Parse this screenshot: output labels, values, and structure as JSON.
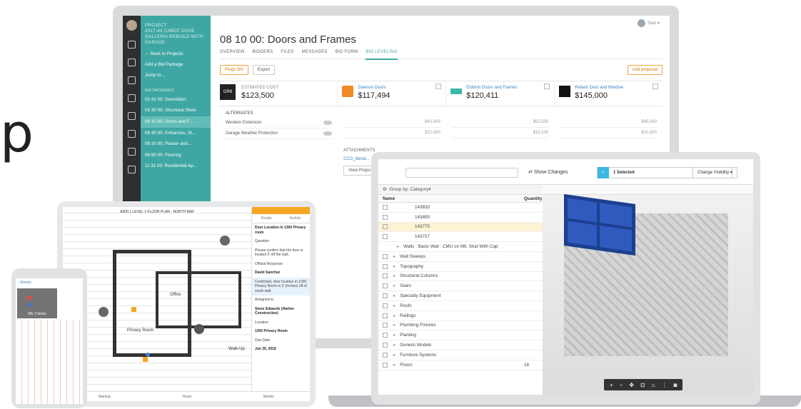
{
  "glyph": "p",
  "desktop": {
    "user": "Stan",
    "project_label": "PROJECT",
    "project_name": "2017-43 CABOT COVE GALLERIA REBUILD WITH GARAGE",
    "nav": [
      "← Back to Projects",
      "Add a Bid Package",
      "Jump to..."
    ],
    "bid_packages_label": "BID PACKAGES",
    "packages": [
      "02 41 00: Demolition",
      "03 30 00: Structural Steel",
      "08 10 00: Doors and F...",
      "08 40 00: Entrances, St...",
      "09 20 00: Plaster and...",
      "09 60 00: Flooring",
      "11 31 00: Residential Ap..."
    ],
    "title": "08 10 00: Doors and Frames",
    "tabs": [
      "OVERVIEW",
      "BIDDERS",
      "FILES",
      "MESSAGES",
      "BID FORM",
      "BID LEVELING"
    ],
    "plugs_btn": "Plugs ON",
    "export_btn": "Export",
    "add_proposal_btn": "Add proposal",
    "estimated_label": "ESTIMATED COST",
    "estimated_value": "$123,500",
    "bids": [
      {
        "name": "Dawson Doors",
        "amount": "$117,494"
      },
      {
        "name": "Eidolon Doors and Frames",
        "amount": "$120,411"
      },
      {
        "name": "Reliant Door and Window",
        "amount": "$145,000"
      }
    ],
    "alternates_label": "ALTERNATES",
    "alternates": [
      "Western Extension",
      "Garage Weather Protection"
    ],
    "alt_values": [
      [
        "$42,000",
        "$52,500",
        "$45,000"
      ],
      [
        "$12,000",
        "$10,100",
        "$10,300"
      ]
    ],
    "attachments_label": "ATTACHMENTS",
    "attachment_file": "CCG_literat...",
    "view_proposal": "View Propo..."
  },
  "model": {
    "show_changes": "Show Changes",
    "selected": "1 Selected",
    "visibility": "Change Visibility",
    "group_by": "Group by: Category",
    "col_name": "Name",
    "col_qty": "Quantity",
    "ids": [
      "143833",
      "143800",
      "143770",
      "143727"
    ],
    "walls_row": "Walls : Basic Wall : CMU on Mtl. Stud With Cap",
    "categories": [
      "Wall Sweeps",
      "Topography",
      "Structural Columns",
      "Stairs",
      "Specialty Equipment",
      "Roofs",
      "Railings",
      "Plumbing Fixtures",
      "Planting",
      "Generic Models",
      "Furniture Systems",
      "Floors"
    ],
    "floors_qty": "18"
  },
  "tablet": {
    "plan_title": "A300.1 LEVEL 1 FLOOR PLAN - NORTH BAR",
    "tab_details": "Details",
    "tab_activity": "Activity",
    "issue_title": "Door Location in 1300 Privacy room",
    "question_label": "Question",
    "question": "Please confirm that the door is located 3' off the wall.",
    "answer_label": "Official Response",
    "responder": "David Sanchez",
    "answer": "Confirmed, door location in 1300 Privacy Room is 3' (inches) off of south wall.",
    "assigned_label": "Assigned to",
    "assigned": "Steve Edwards (Harbor Construction)",
    "location_label": "Location",
    "location": "1300 Privacy Room",
    "due_label": "Due Date",
    "due": "Jun 30, 2018",
    "bottom_tabs": [
      "Markup",
      "Views",
      "Sheets"
    ],
    "rooms": [
      "Privacy Room",
      "Walk-Up",
      "Office"
    ]
  },
  "phone": {
    "back": "‹ Sheets",
    "count": "Rfc 3 items"
  }
}
